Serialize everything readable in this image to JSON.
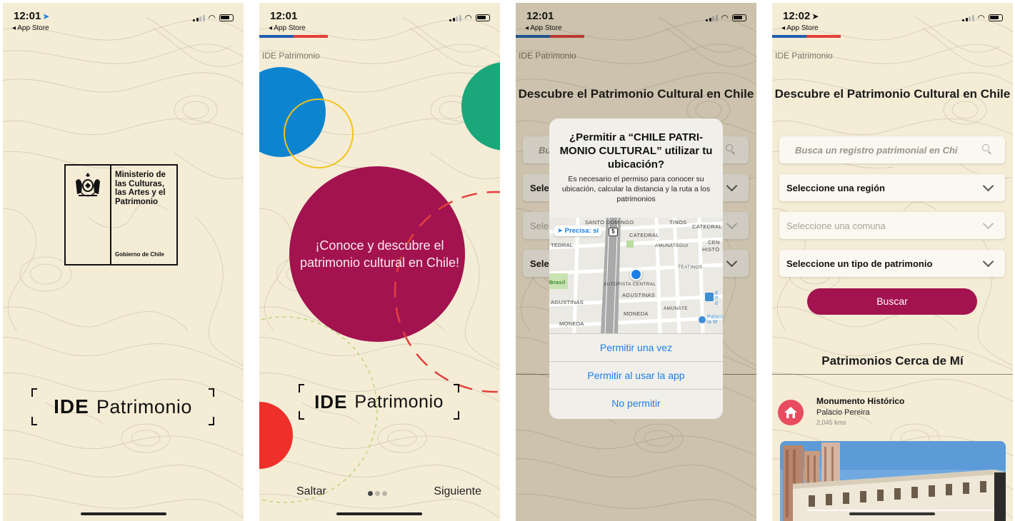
{
  "status_bar": {
    "screen1": {
      "time": "12:01"
    },
    "screen2": {
      "time": "12:01"
    },
    "screen3": {
      "time": "12:01"
    },
    "screen4": {
      "time": "12:02"
    },
    "back_label": "◂ App Store"
  },
  "app_label": "IDE Patrimonio",
  "splash": {
    "ministry_name": "Ministerio de las Culturas, las Artes y el Patrimonio",
    "government": "Gobierno de Chile",
    "brand_bold": "IDE",
    "brand_light": "Patrimonio"
  },
  "onboarding": {
    "message": "¡Conoce y descubre el patrimonio cultural en Chile!",
    "skip_label": "Saltar",
    "next_label": "Siguiente",
    "page_count": 3,
    "current_page": 1
  },
  "main": {
    "title": "Descubre el Patrimonio Cultural en Chile",
    "search_placeholder": "Busca un registro patrimonial en Chi",
    "search_placeholder_short": "Bu",
    "region_label": "Seleccione una región",
    "comuna_label": "Seleccione una comuna",
    "type_label": "Seleccione un tipo de patrimonio",
    "sel_short": "Selec",
    "sel_short2": "Sele",
    "search_button": "Buscar",
    "nearby_title": "Patrimonios Cerca de Mí",
    "nearby": [
      {
        "type": "Monumento Histórico",
        "name": "Palacio Pereira",
        "distance": "2,045 kms"
      }
    ]
  },
  "permission_alert": {
    "title": "¿Permitir a “CHILE PATRI-MONIO CULTURAL” utilizar tu ubicación?",
    "message": "Es necesario el permiso para conocer su ubicación, calcular la distancia y la ruta a los patrimonios",
    "precise_label": "Precisa: sí",
    "route_number": "5",
    "map_labels": [
      "SANTO DOMINGO",
      "CATEDRAL",
      "CATEDRAL",
      "TEDRAL",
      "TINOS",
      "CEN",
      "HISTÓ",
      "AMUNÁTEGUI",
      "TEATINOS",
      "Brasil",
      "AGUSTINAS",
      "AGUSTINAS",
      "AUTOPISTA CENTRAL",
      "MONEDA",
      "MONEDA",
      "AMUNÁTE",
      "Palacio la M",
      "E P d"
    ],
    "buttons": [
      "Permitir una vez",
      "Permitir al usar la app",
      "No permitir"
    ]
  },
  "colors": {
    "background": "#f5ecd6",
    "accent": "#a3134f",
    "flag_blue": "#1f5fae",
    "flag_red": "#e2403c",
    "ios_blue": "#1a7fe6",
    "circle_blue": "#0d84cf",
    "circle_green": "#1aa77a",
    "circle_red": "#ee2f2a",
    "circle_yellow": "#f2c41a"
  }
}
